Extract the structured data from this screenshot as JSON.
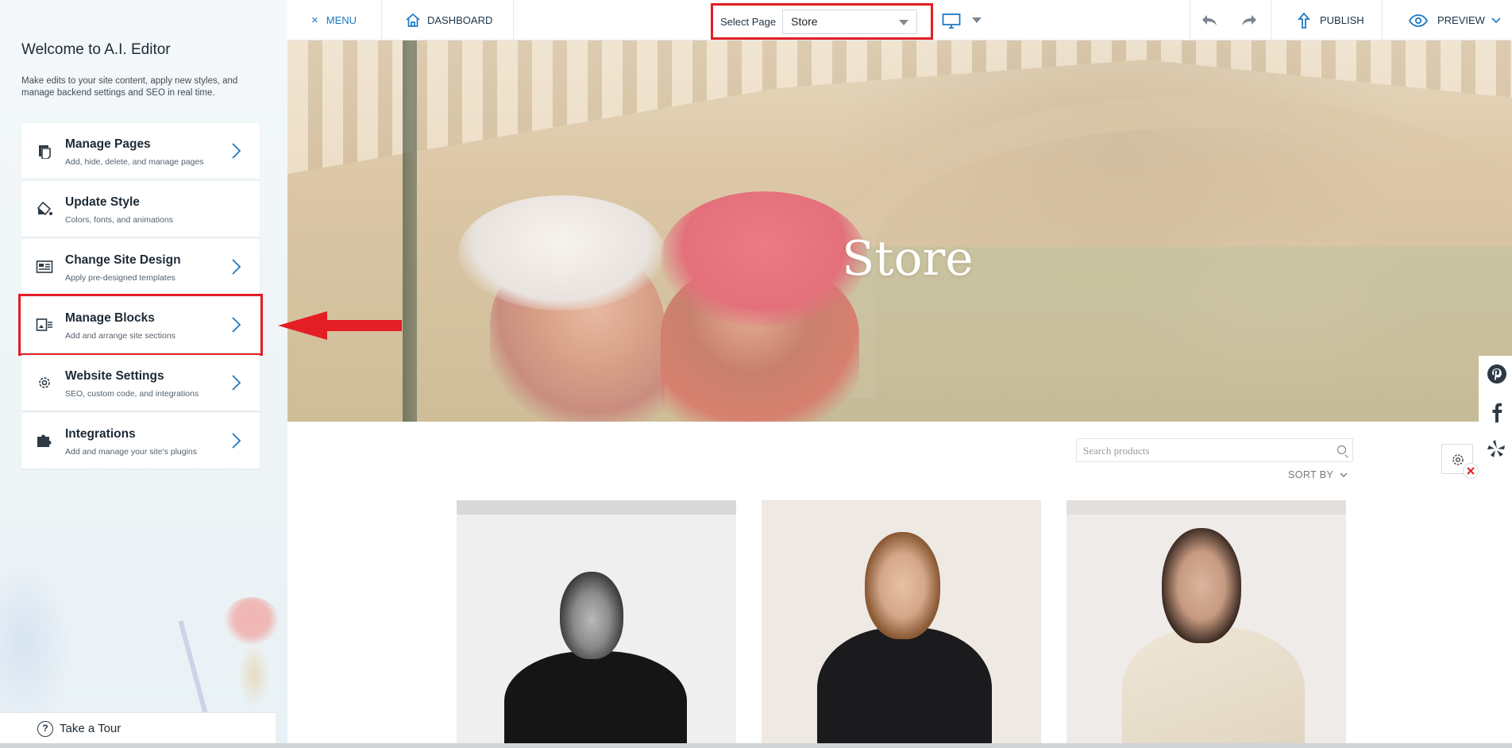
{
  "sidebar": {
    "title": "Welcome to A.I. Editor",
    "subtitle": "Make edits to your site content, apply new styles, and manage backend settings and SEO in real time.",
    "items": [
      {
        "title": "Manage Pages",
        "desc": "Add, hide, delete, and manage pages",
        "icon": "pages-icon"
      },
      {
        "title": "Update Style",
        "desc": "Colors, fonts, and animations",
        "icon": "paint-bucket-icon"
      },
      {
        "title": "Change Site Design",
        "desc": "Apply pre-designed templates",
        "icon": "layout-icon"
      },
      {
        "title": "Manage Blocks",
        "desc": "Add and arrange site sections",
        "icon": "blocks-icon"
      },
      {
        "title": "Website Settings",
        "desc": "SEO, custom code, and integrations",
        "icon": "gear-icon"
      },
      {
        "title": "Integrations",
        "desc": "Add and manage your site's plugins",
        "icon": "puzzle-icon"
      }
    ],
    "tour_label": "Take a Tour"
  },
  "topbar": {
    "menu_label": "MENU",
    "dashboard_label": "DASHBOARD",
    "select_page_label": "Select Page",
    "select_page_value": "Store",
    "publish_label": "PUBLISH",
    "preview_label": "PREVIEW"
  },
  "hero": {
    "title": "Store"
  },
  "store": {
    "search_placeholder": "Search products",
    "sort_label": "SORT BY"
  },
  "colors": {
    "accent_blue": "#1d79c4",
    "highlight_red": "#e31e24"
  }
}
